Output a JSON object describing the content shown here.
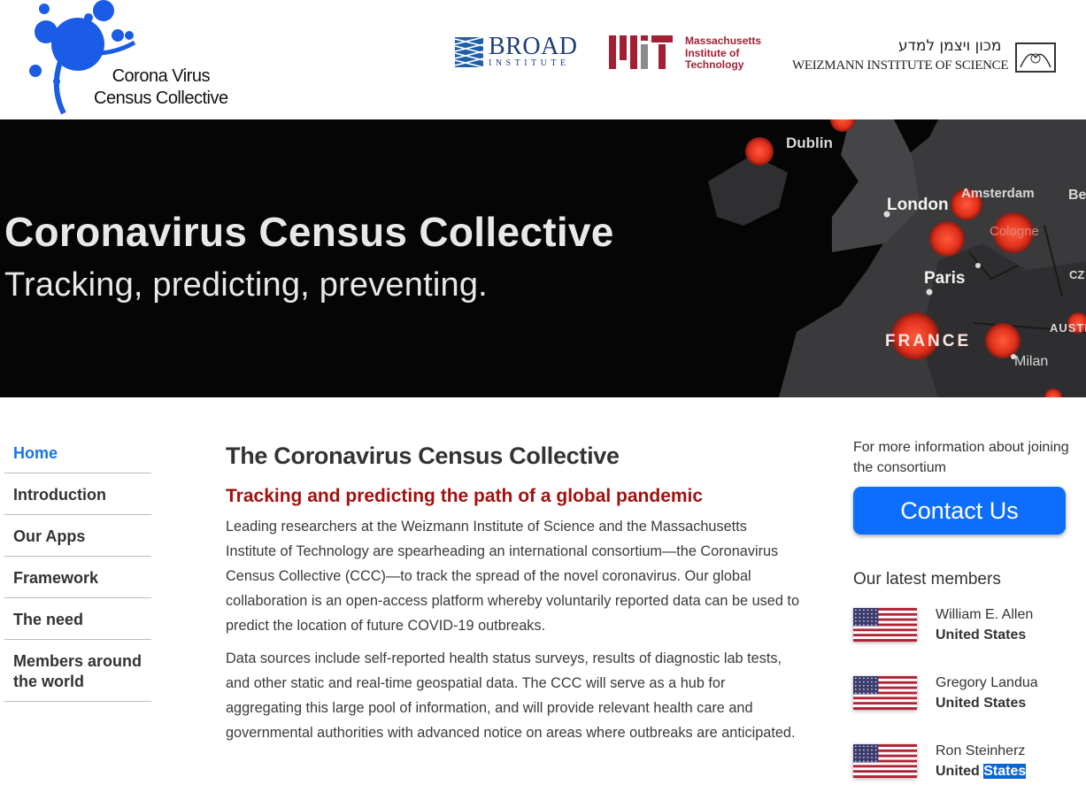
{
  "header": {
    "logo_line1": "Corona Virus",
    "logo_line2": "Census Collective",
    "partners": {
      "broad_line1": "BROAD",
      "broad_line2": "INSTITUTE",
      "mit_line1": "Massachusetts",
      "mit_line2": "Institute of",
      "mit_line3": "Technology",
      "weizmann_hebrew": "מכון ויצמן למדע",
      "weizmann_english": "WEIZMANN INSTITUTE OF SCIENCE"
    }
  },
  "hero": {
    "title": "Coronavirus Census Collective",
    "subtitle": "Tracking, predicting, preventing.",
    "map_labels": [
      "Dublin",
      "London",
      "Amsterdam",
      "Cologne",
      "Paris",
      "FRANCE",
      "Milan",
      "Be",
      "CZ",
      "AUSTR"
    ]
  },
  "nav": {
    "items": [
      {
        "label": "Home",
        "active": true
      },
      {
        "label": "Introduction",
        "active": false
      },
      {
        "label": "Our Apps",
        "active": false
      },
      {
        "label": "Framework",
        "active": false
      },
      {
        "label": "The need",
        "active": false
      },
      {
        "label": "Members around the world",
        "active": false
      }
    ]
  },
  "main": {
    "title": "The Coronavirus Census Collective",
    "subtitle": "Tracking and predicting the path of a global pandemic",
    "paragraph1": "Leading researchers at the Weizmann Institute of Science and the Massachusetts Institute of Technology are spearheading an international consortium—the Coronavirus Census Collective (CCC)—to track the spread of the novel coronavirus. Our global collaboration is an open-access platform whereby voluntarily reported data can be used to predict the location of future COVID-19 outbreaks.",
    "paragraph2": "Data sources include self-reported health status surveys, results of diagnostic lab tests, and other static and real-time geospatial data. The CCC will serve as a hub for aggregating this large pool of information, and will provide relevant health care and governmental authorities with advanced notice on areas where outbreaks are anticipated."
  },
  "sidebar_right": {
    "more_info": "For more information about joining the consortium",
    "contact_label": "Contact Us",
    "latest_heading": "Our latest members",
    "members": [
      {
        "name": "William E. Allen",
        "country": "United States"
      },
      {
        "name": "Gregory Landua",
        "country": "United States"
      },
      {
        "name": "Ron Steinherz",
        "country_part1": "United",
        "country_part2": "States"
      }
    ]
  },
  "colors": {
    "accent": "#0d6efd",
    "nav_active": "#1a73e8",
    "subtitle_red": "#a1110f",
    "hero_bg": "#050505"
  }
}
